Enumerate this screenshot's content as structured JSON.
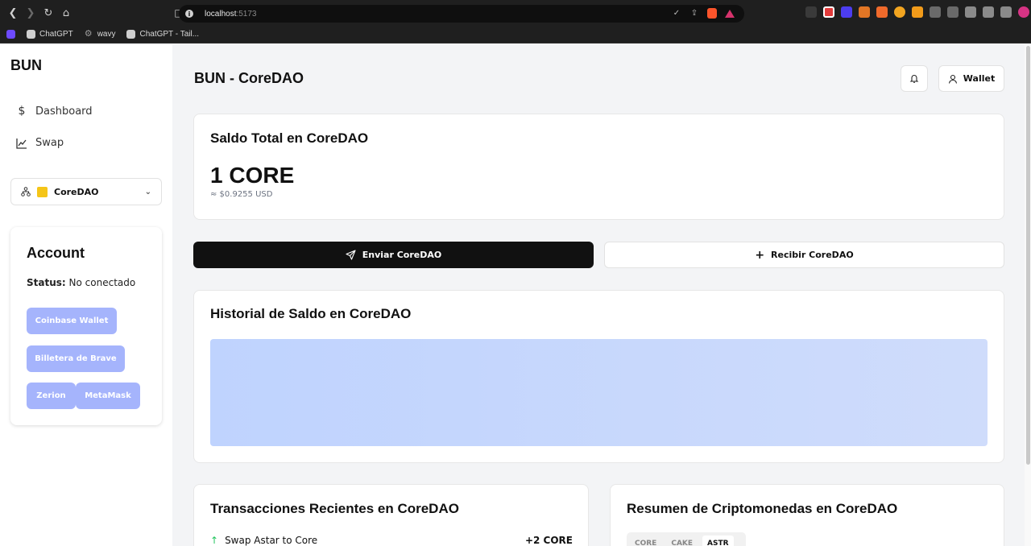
{
  "browser": {
    "url_host": "localhost",
    "url_port": ":5173",
    "bookmarks": [
      {
        "label": "ChatGPT"
      },
      {
        "label": "wavy"
      },
      {
        "label": "ChatGPT - Tail..."
      }
    ]
  },
  "sidebar": {
    "brand": "BUN",
    "items": [
      {
        "label": "Dashboard",
        "icon": "dollar-icon"
      },
      {
        "label": "Swap",
        "icon": "chart-line-icon"
      }
    ],
    "network": {
      "label": "CoreDAO",
      "color": "#f5c518"
    }
  },
  "account": {
    "title": "Account",
    "status_label": "Status:",
    "status_value": "No conectado",
    "wallets": [
      "Coinbase Wallet",
      "Billetera de Brave",
      "Zerion",
      "MetaMask"
    ],
    "button_color": "#a5b4fc"
  },
  "header": {
    "title": "BUN - CoreDAO",
    "wallet_label": "Wallet"
  },
  "balance": {
    "title": "Saldo Total en CoreDAO",
    "amount": "1 CORE",
    "usd": "≈ $0.9255 USD"
  },
  "actions": {
    "send_label": "Enviar CoreDAO",
    "receive_label": "Recibir CoreDAO"
  },
  "history": {
    "title": "Historial de Saldo en CoreDAO"
  },
  "transactions": {
    "title": "Transacciones Recientes en CoreDAO",
    "rows": [
      {
        "label": "Swap Astar to Core",
        "amount": "+2 CORE"
      }
    ]
  },
  "summary": {
    "title": "Resumen de Criptomonedas en CoreDAO",
    "tabs": [
      "CORE",
      "CAKE",
      "ASTR"
    ],
    "active_tab": "ASTR"
  }
}
